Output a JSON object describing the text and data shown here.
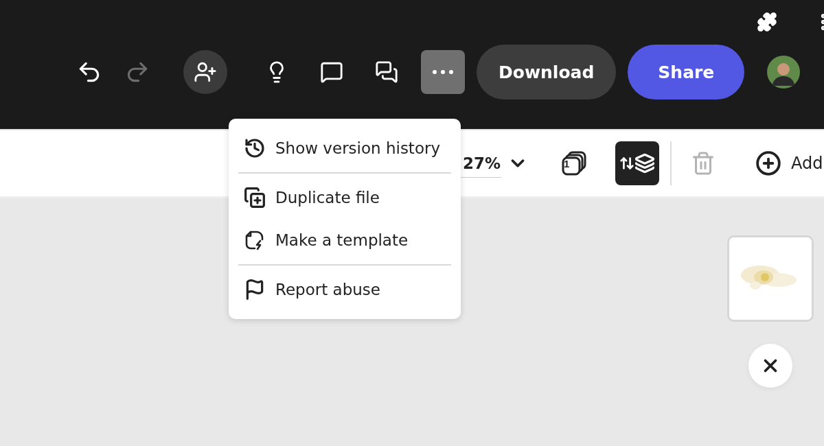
{
  "top_bar": {
    "undo": {
      "disabled": false
    },
    "redo": {
      "disabled": true
    },
    "more": {
      "expanded": true
    },
    "download": {
      "label": "Download"
    },
    "share": {
      "label": "Share"
    }
  },
  "toolbar": {
    "zoom": "27%",
    "page_count": "1",
    "layers": {
      "selected": true
    },
    "delete": {
      "disabled": true
    },
    "add": {
      "label": "Add"
    }
  },
  "menu": {
    "groups": [
      [
        {
          "label": "Show version history"
        }
      ],
      [
        {
          "label": "Duplicate file"
        },
        {
          "label": "Make a template"
        }
      ],
      [
        {
          "label": "Report abuse"
        }
      ]
    ]
  }
}
